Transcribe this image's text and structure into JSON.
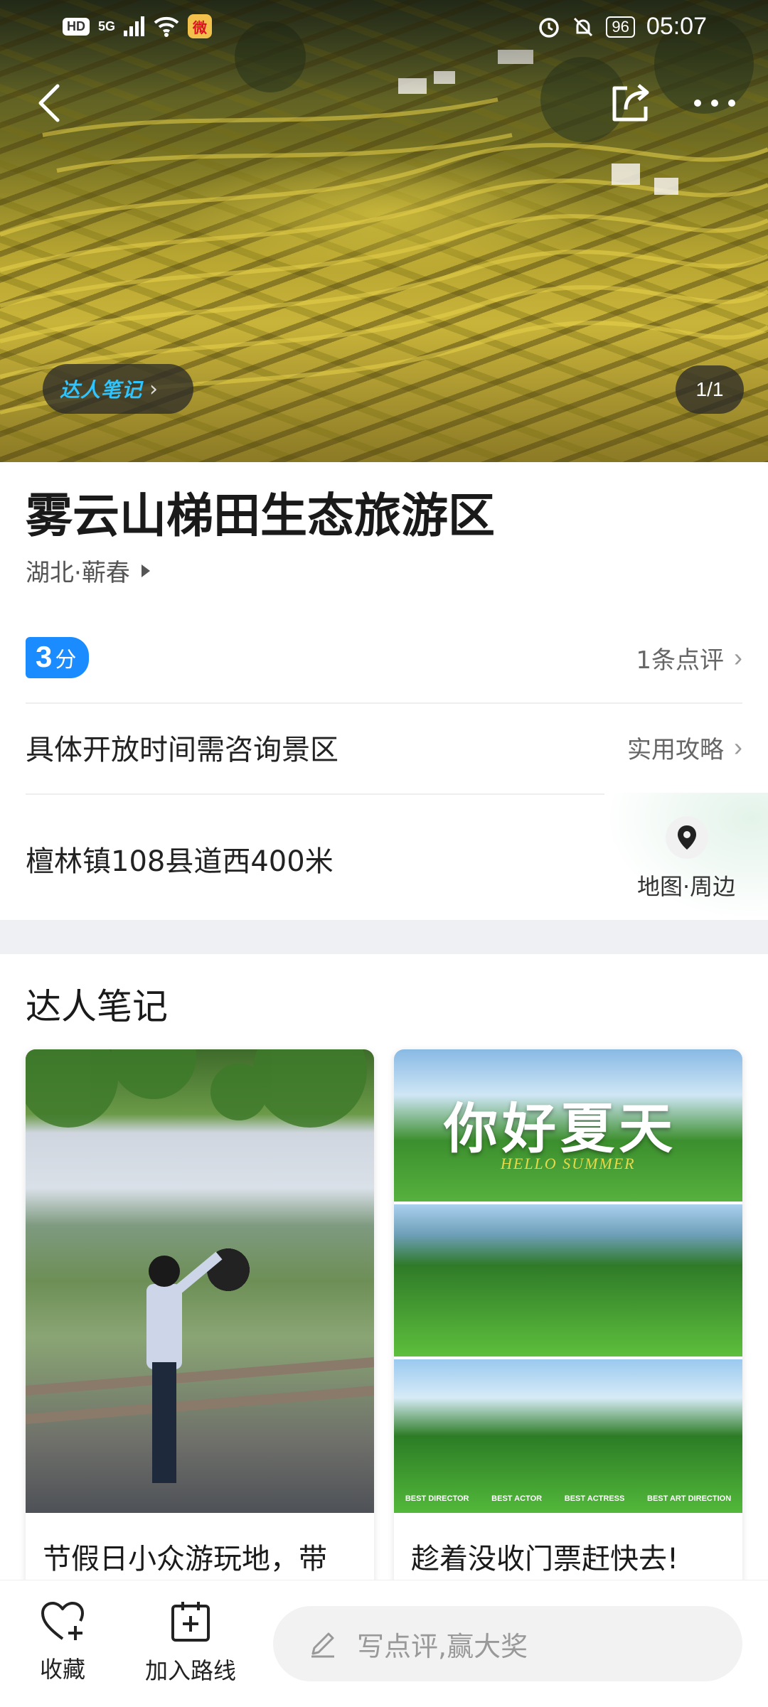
{
  "status": {
    "hd": "HD",
    "network": "5G",
    "battery": "96",
    "time": "05:07",
    "weibo_icon_text": "微"
  },
  "hero": {
    "notes_pill": "达人笔记",
    "page_indicator": "1/1"
  },
  "attraction": {
    "title": "雾云山梯田生态旅游区",
    "location": "湖北·蕲春",
    "score_num": "3",
    "score_unit": "分",
    "reviews_link": "1条点评",
    "hours": "具体开放时间需咨询景区",
    "guide_link": "实用攻略",
    "address": "檀林镇108县道西400米",
    "map_label": "地图·周边"
  },
  "notes_section": {
    "title": "达人笔记",
    "cards": [
      {
        "title": "节假日小众游玩地，带"
      },
      {
        "title": "趁着没收门票赶快去!",
        "overlay_title": "你好夏天",
        "overlay_sub": "HELLO SUMMER",
        "credits": [
          "BEST DIRECTOR",
          "BEST ACTOR",
          "BEST ACTRESS",
          "BEST ART DIRECTION"
        ]
      }
    ]
  },
  "bottom_bar": {
    "favorite_label": "收藏",
    "add_route_label": "加入路线",
    "review_placeholder": "写点评,赢大奖"
  },
  "colors": {
    "accent": "#1a8cff",
    "notes_pill_text": "#2ec4ff",
    "section_gap": "#eef0f3"
  }
}
